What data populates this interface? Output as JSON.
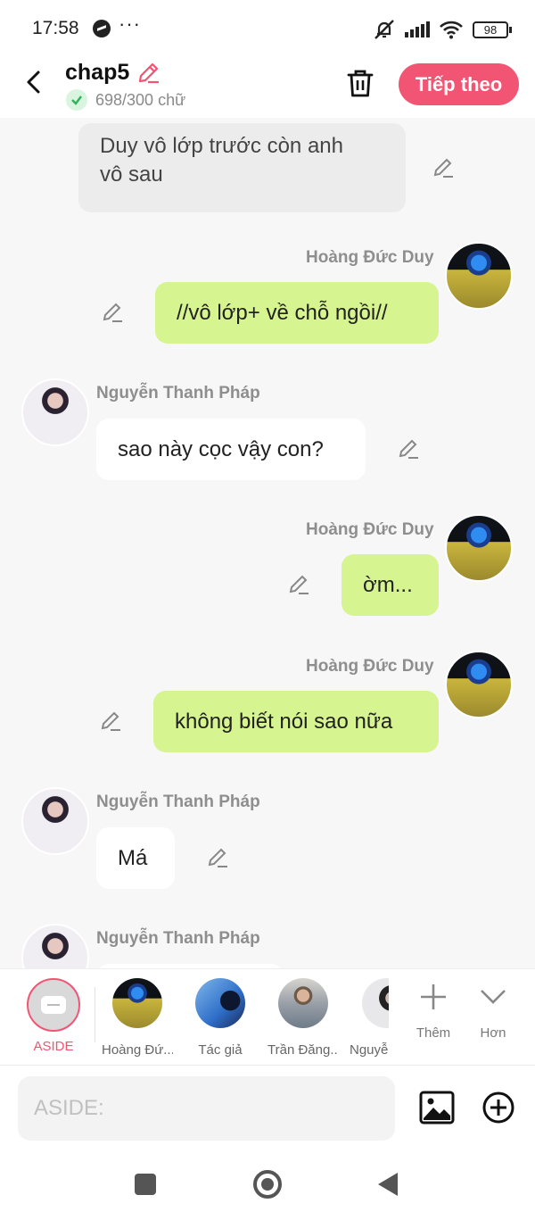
{
  "status_bar": {
    "time": "17:58",
    "dots": "···",
    "battery": "98"
  },
  "header": {
    "title": "chap5",
    "word_count": "698/300 chữ",
    "next_label": "Tiếp theo"
  },
  "messages": [
    {
      "type": "aside",
      "text_line1": "Duy vô lớp trước còn anh",
      "text_line2": "vô sau"
    },
    {
      "type": "right",
      "sender": "Hoàng Đức Duy",
      "text": "//vô lớp+ về chỗ ngồi//"
    },
    {
      "type": "left",
      "sender": "Nguyễn Thanh Pháp",
      "text": "sao này cọc vậy con?"
    },
    {
      "type": "right",
      "sender": "Hoàng Đức Duy",
      "text": "ờm..."
    },
    {
      "type": "right",
      "sender": "Hoàng Đức Duy",
      "text": "không biết nói sao nữa"
    },
    {
      "type": "left",
      "sender": "Nguyễn Thanh Pháp",
      "text": "Má"
    },
    {
      "type": "left",
      "sender": "Nguyễn Thanh Pháp",
      "text": ""
    }
  ],
  "characters": {
    "aside_label": "ASIDE",
    "items": [
      {
        "label": "Hoàng Đứ..."
      },
      {
        "label": "Tác giả"
      },
      {
        "label": "Trần Đăng..."
      },
      {
        "label": "Nguyễ"
      }
    ],
    "add_label": "Thêm",
    "more_label": "Hơn"
  },
  "composer": {
    "placeholder": "ASIDE:"
  },
  "colors": {
    "accent": "#f25473",
    "right_bubble": "#d6f48f",
    "left_bubble": "#ffffff",
    "aside_bubble": "#ececec"
  }
}
